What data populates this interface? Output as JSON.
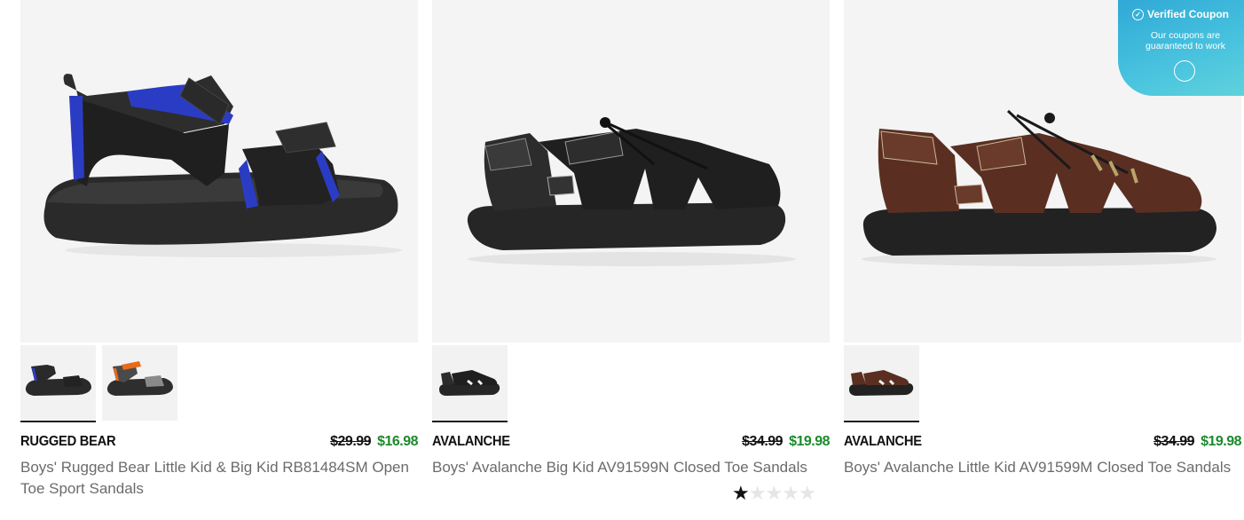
{
  "products": [
    {
      "brand": "RUGGED BEAR",
      "old_price": "$29.99",
      "price": "$16.98",
      "title": "Boys' Rugged Bear Little Kid & Big Kid RB81484SM Open Toe Sport Sandals",
      "image": "blue-black-sport-sandal",
      "thumbnails": [
        "blue-black-sandal-thumb",
        "orange-gray-sandal-thumb"
      ]
    },
    {
      "brand": "AVALANCHE",
      "old_price": "$34.99",
      "price": "$19.98",
      "title": "Boys' Avalanche Big Kid AV91599N Closed Toe Sandals",
      "image": "black-closed-toe-sandal",
      "thumbnails": [
        "black-sandal-thumb"
      ],
      "rating": {
        "filled": 1,
        "total": 5
      }
    },
    {
      "brand": "AVALANCHE",
      "old_price": "$34.99",
      "price": "$19.98",
      "title": "Boys' Avalanche Little Kid AV91599M Closed Toe Sandals",
      "image": "brown-closed-toe-sandal",
      "thumbnails": [
        "brown-sandal-thumb"
      ]
    }
  ],
  "coupon": {
    "title": "Verified Coupon",
    "text": "Our coupons are guaranteed to work",
    "check_icon": "check-circle-icon",
    "logo_icon": "coupon-logo-icon"
  },
  "colors": {
    "sale_price": "#1a8a2d",
    "hero_bg": "#f4f4f4",
    "coupon_bg": "#3db7da"
  }
}
